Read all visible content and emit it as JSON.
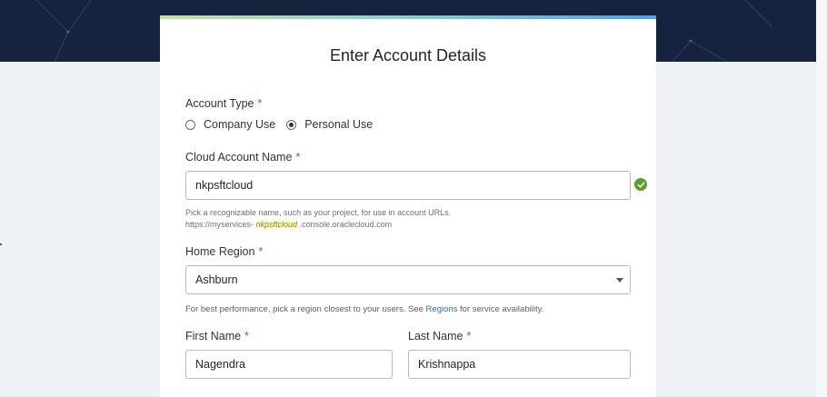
{
  "title": "Enter Account Details",
  "account_type": {
    "label": "Account Type",
    "required_mark": "*",
    "options": [
      {
        "label": "Company Use",
        "checked": false
      },
      {
        "label": "Personal Use",
        "checked": true
      }
    ]
  },
  "cloud_account": {
    "label": "Cloud Account Name",
    "required_mark": "*",
    "value": "nkpsftcloud",
    "status_icon": "check-circle-icon",
    "help_line1": "Pick a recognizable name, such as your project, for use in account URLs.",
    "url_prefix": "https://myservices-",
    "url_slug": "nkpsftcloud",
    "url_suffix": ".console.oraclecloud.com"
  },
  "home_region": {
    "label": "Home Region",
    "required_mark": "*",
    "value": "Ashburn",
    "help_before": "For best performance, pick a region closest to your users. See ",
    "help_link": "Regions",
    "help_after": " for service availability."
  },
  "first_name": {
    "label": "First Name",
    "required_mark": "*",
    "value": "Nagendra"
  },
  "last_name": {
    "label": "Last Name",
    "required_mark": "*",
    "value": "Krishnappa"
  },
  "colors": {
    "hero": "#15233f",
    "required": "#c74634",
    "link": "#2e6fb8",
    "valid": "#5c9e2d"
  }
}
